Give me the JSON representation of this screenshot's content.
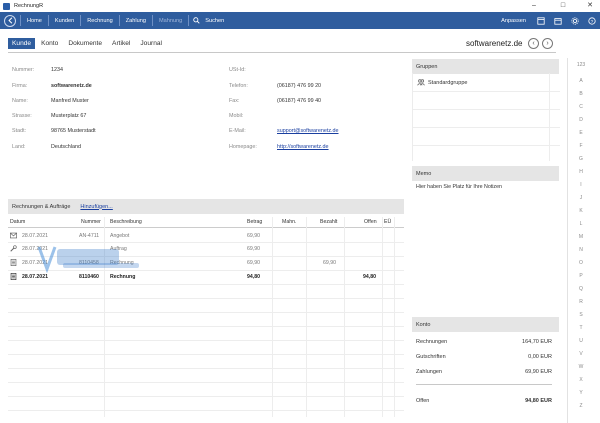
{
  "window": {
    "title": "RechnungR",
    "controls": {
      "minimize": "–",
      "maximize": "□",
      "close": "✕"
    }
  },
  "menubar": {
    "items": [
      "Home",
      "Kunden",
      "Rechnung",
      "Zahlung",
      "Mahnung"
    ],
    "disabled_index": 4,
    "search_label": "Suchen",
    "customize_label": "Anpassen"
  },
  "tabs": [
    "Kunde",
    "Konto",
    "Dokumente",
    "Artikel",
    "Journal"
  ],
  "active_tab": "Kunde",
  "header_title": "softwarenetz.de",
  "customer": {
    "left": [
      {
        "label": "Nummer:",
        "value": "1234"
      },
      {
        "label": "Firma:",
        "value": "softwarenetz.de"
      },
      {
        "label": "Name:",
        "value": "Manfred Muster"
      },
      {
        "label": "Strasse:",
        "value": "Musterplatz 67"
      },
      {
        "label": "Stadt:",
        "value": "98765 Musterstadt"
      },
      {
        "label": "Land:",
        "value": "Deutschland"
      }
    ],
    "right": [
      {
        "label": "USt-Id:",
        "value": ""
      },
      {
        "label": "Telefon:",
        "value": "(06187) 476 99 20"
      },
      {
        "label": "Fax:",
        "value": "(06187) 476 99 40"
      },
      {
        "label": "Mobil:",
        "value": ""
      },
      {
        "label": "E-Mail:",
        "value": "support@softwarenetz.de"
      },
      {
        "label": "Homepage:",
        "value": "http://softwarenetz.de"
      }
    ]
  },
  "gruppen": {
    "title": "Gruppen",
    "items": [
      "Standardgruppe"
    ]
  },
  "memo": {
    "title": "Memo",
    "text": "Hier haben Sie Platz für Ihre Notizen"
  },
  "documents": {
    "title": "Rechnungen & Aufträge",
    "add_link": "Hinzufügen...",
    "columns": [
      "Datum",
      "Nummer",
      "Beschreibung",
      "Betrag",
      "Mahn.",
      "Bezahlt",
      "Offen",
      "EÜ"
    ],
    "rows": [
      {
        "icon": "envelope-icon",
        "datum": "28.07.2021",
        "nummer": "AN-4711",
        "beschreibung": "Angebot",
        "betrag": "69,90",
        "bezahlt": "",
        "offen": "",
        "bold": false
      },
      {
        "icon": "wrench-icon",
        "datum": "28.07.2021",
        "nummer": "",
        "beschreibung": "Auftrag",
        "betrag": "69,90",
        "bezahlt": "",
        "offen": "",
        "bold": false
      },
      {
        "icon": "document-icon",
        "datum": "28.07.2021",
        "nummer": "8110458",
        "beschreibung": "Rechnung",
        "betrag": "69,90",
        "bezahlt": "69,90",
        "offen": "",
        "bold": false
      },
      {
        "icon": "document-icon",
        "datum": "28.07.2021",
        "nummer": "8110460",
        "beschreibung": "Rechnung",
        "betrag": "94,80",
        "bezahlt": "",
        "offen": "94,80",
        "bold": true
      }
    ]
  },
  "konto": {
    "title": "Konto",
    "rows": [
      {
        "label": "Rechnungen",
        "value": "164,70 EUR"
      },
      {
        "label": "Gutschriften",
        "value": "0,00 EUR"
      },
      {
        "label": "Zahlungen",
        "value": "69,90 EUR"
      }
    ],
    "total": {
      "label": "Offen",
      "value": "94,80 EUR"
    }
  },
  "alphabet": [
    "123",
    "A",
    "B",
    "C",
    "D",
    "E",
    "F",
    "G",
    "H",
    "I",
    "J",
    "K",
    "L",
    "M",
    "N",
    "O",
    "P",
    "Q",
    "R",
    "S",
    "T",
    "U",
    "V",
    "W",
    "X",
    "Y",
    "Z"
  ],
  "colors": {
    "accent": "#2f5d9e",
    "panel_header": "#e5e5e5",
    "link": "#1a3fa0"
  }
}
